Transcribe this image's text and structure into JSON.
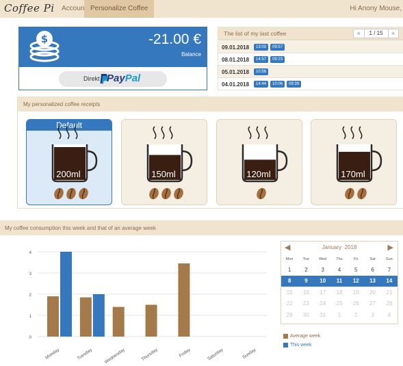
{
  "navbar": {
    "brand": "Coffee Pi",
    "account": "Account",
    "personalize": "Personalize Coffee",
    "greeting": "Hi Anony Mouse,"
  },
  "balance": {
    "amount": "-21.00 €",
    "label": "Balance",
    "paypal_prefix": "Direkt zu",
    "paypal_pay": "Pay",
    "paypal_pal": "Pal"
  },
  "coffee_list": {
    "title": "The list of my last coffee",
    "pager_prev": "«",
    "pager_page": "1 / 15",
    "pager_next": "»",
    "rows": [
      {
        "date": "09.01.2018",
        "times": [
          "13:03",
          "09:57"
        ]
      },
      {
        "date": "08.01.2018",
        "times": [
          "14:57",
          "09:23"
        ]
      },
      {
        "date": "05.01.2018",
        "times": [
          "10:58"
        ]
      },
      {
        "date": "04.01.2018",
        "times": [
          "14:44",
          "10:06",
          "09:39"
        ]
      }
    ]
  },
  "receipts": {
    "title": "My personalized coffee receipts",
    "default_label": "Default",
    "cups": [
      {
        "label": "200ml",
        "fill": 1.0,
        "beans": 3,
        "selected": true
      },
      {
        "label": "150ml",
        "fill": 0.75,
        "beans": 3,
        "selected": false
      },
      {
        "label": "120ml",
        "fill": 0.6,
        "beans": 1,
        "selected": false
      },
      {
        "label": "170ml",
        "fill": 0.85,
        "beans": 2,
        "selected": false
      }
    ]
  },
  "consumption": {
    "title": "My coffee consumption this week and that of an average week"
  },
  "calendar": {
    "prev": "◀",
    "next": "▶",
    "month": "January",
    "year": "2018",
    "dow": [
      "Mon",
      "Tue",
      "Wed",
      "Thu",
      "Fri",
      "Sat",
      "Sun"
    ],
    "weeks": [
      {
        "days": [
          "1",
          "2",
          "3",
          "4",
          "5",
          "6",
          "7"
        ],
        "kind": "normal"
      },
      {
        "days": [
          "8",
          "9",
          "10",
          "11",
          "12",
          "13",
          "14"
        ],
        "kind": "current"
      },
      {
        "days": [
          "15",
          "16",
          "17",
          "18",
          "19",
          "20",
          "21"
        ],
        "kind": "faded"
      },
      {
        "days": [
          "22",
          "23",
          "24",
          "25",
          "26",
          "27",
          "28"
        ],
        "kind": "faded"
      },
      {
        "days": [
          "29",
          "30",
          "31",
          "1",
          "2",
          "3",
          "4"
        ],
        "kind": "faded"
      }
    ]
  },
  "legend": {
    "average": "Average week",
    "week": "This week"
  },
  "colors": {
    "average": "#a57a4a",
    "week": "#3678bd",
    "nav_bg": "#f1e4cf",
    "accent": "#3678bd"
  },
  "chart_data": {
    "type": "bar",
    "categories": [
      "Monday",
      "Tuesday",
      "Wednesday",
      "Thursday",
      "Friday",
      "Saturday",
      "Sunday"
    ],
    "series": [
      {
        "name": "Average week",
        "values": [
          1.9,
          1.85,
          1.4,
          1.5,
          3.45,
          0,
          0
        ]
      },
      {
        "name": "This week",
        "values": [
          4,
          2,
          0,
          0,
          0,
          0,
          0
        ]
      }
    ],
    "ylim": [
      0,
      4
    ],
    "yticks": [
      "0",
      "1",
      "2",
      "3",
      "4"
    ],
    "grid": true
  }
}
